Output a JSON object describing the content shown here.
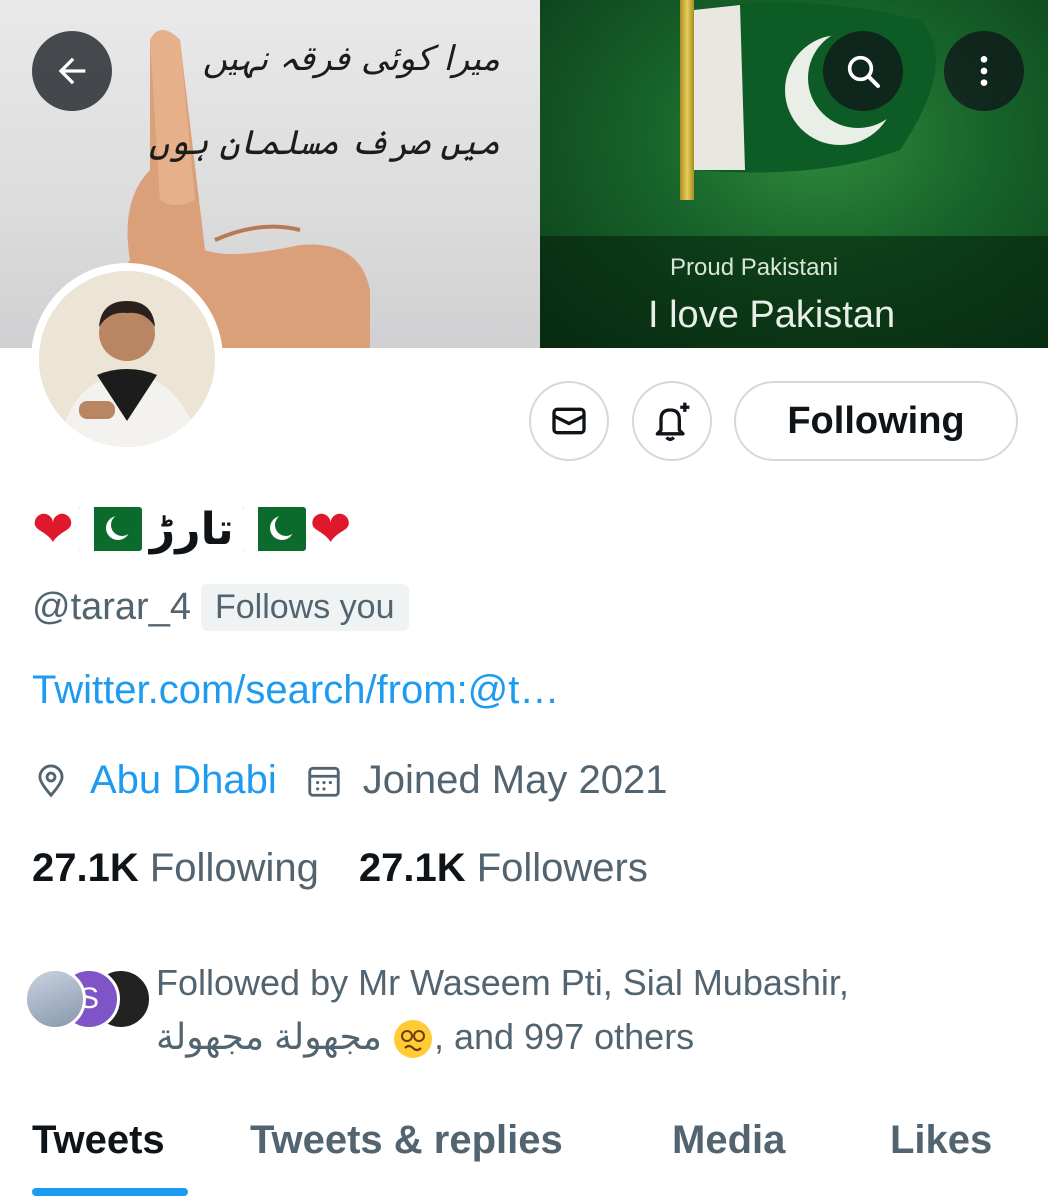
{
  "banner": {
    "urdu_line1": "میرا کوئی فرقہ نہیں",
    "urdu_line2": "میں صرف مسلمان ہوں",
    "caption_small": "Proud Pakistani",
    "caption_large": "I love Pakistan"
  },
  "header": {
    "back_icon": "arrow-left-icon",
    "search_icon": "search-icon",
    "more_icon": "more-vertical-icon"
  },
  "actions": {
    "message_icon": "envelope-icon",
    "notify_icon": "bell-plus-icon",
    "following_label": "Following"
  },
  "profile": {
    "name_urdu": "تارڑ",
    "handle": "@tarar_4",
    "follows_you": "Follows you",
    "link": "Twitter.com/search/from:@t…",
    "location": "Abu Dhabi",
    "joined": "Joined May 2021",
    "following_count": "27.1K",
    "following_label": "Following",
    "followers_count": "27.1K",
    "followers_label": "Followers"
  },
  "followed_by": {
    "line1": "Followed by Mr Waseem Pti, Sial Mubashir,",
    "name_arabic": "مجهولة مجهولة",
    "line2_suffix": ", and 997 others",
    "avatar2_initial": "S"
  },
  "tabs": [
    {
      "label": "Tweets",
      "active": true
    },
    {
      "label": "Tweets & replies",
      "active": false
    },
    {
      "label": "Media",
      "active": false
    },
    {
      "label": "Likes",
      "active": false
    }
  ],
  "colors": {
    "accent": "#1d9bf0",
    "text_primary": "#0f1419",
    "text_secondary": "#536471",
    "border": "#cfd9de"
  }
}
